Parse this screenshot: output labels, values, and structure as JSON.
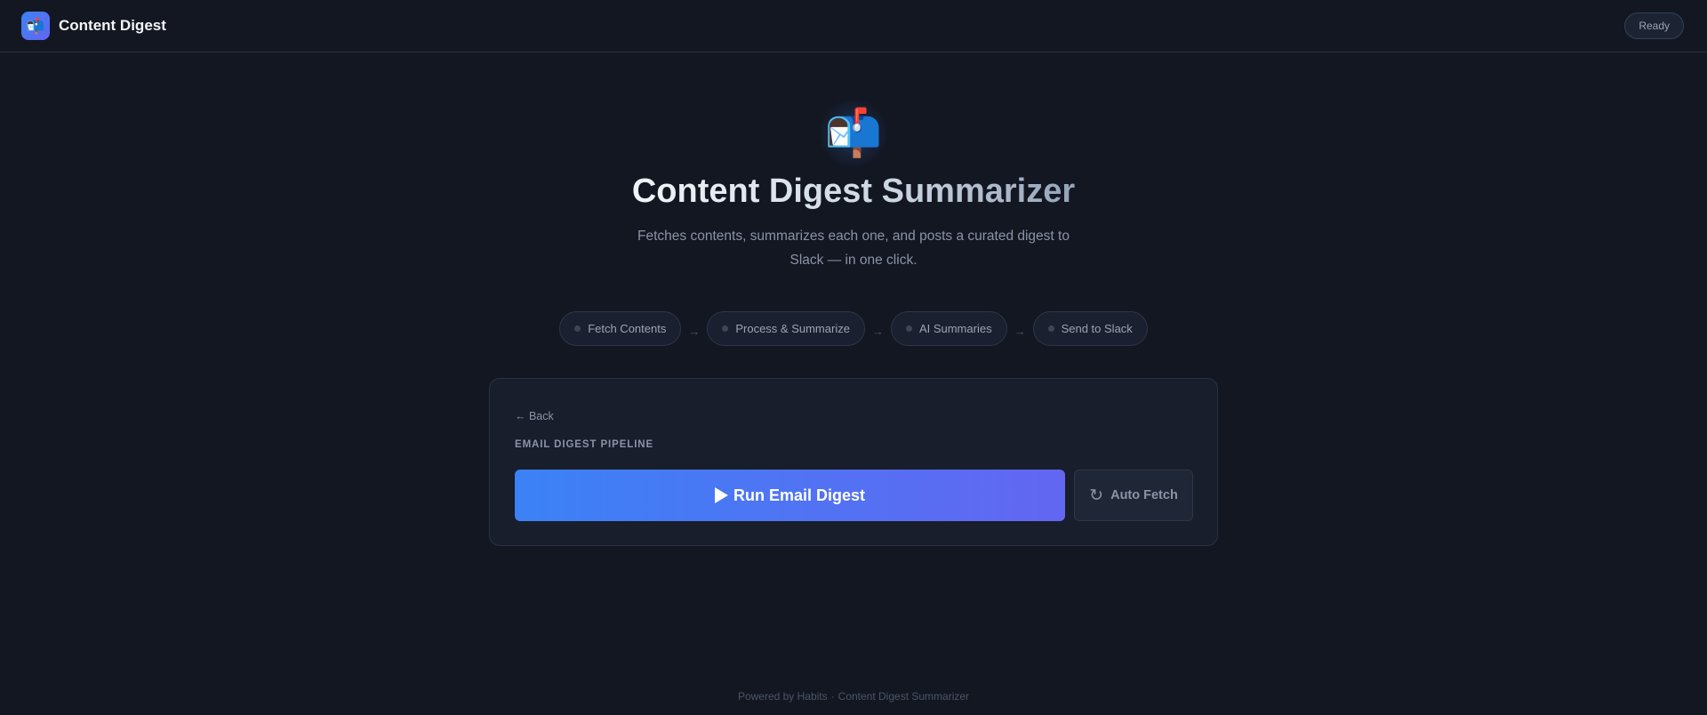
{
  "header": {
    "logo_icon": "📬",
    "app_name": "Content Digest",
    "status": "Ready"
  },
  "hero": {
    "icon": "📬",
    "title": "Content Digest Summarizer",
    "subtitle": "Fetches contents, summarizes each one, and posts a curated digest to Slack — in one click."
  },
  "steps": [
    {
      "label": "Fetch Contents"
    },
    {
      "label": "Process & Summarize"
    },
    {
      "label": "AI Summaries"
    },
    {
      "label": "Send to Slack"
    }
  ],
  "step_arrow": "→",
  "card": {
    "back_label": "← Back",
    "section_label": "EMAIL DIGEST PIPELINE",
    "run_label": "Run Email Digest",
    "auto_fetch_icon": "↻",
    "auto_fetch_label": "Auto Fetch"
  },
  "footer": {
    "powered_by": "Powered by Habits",
    "separator": "·",
    "app": "Content Digest Summarizer"
  },
  "colors": {
    "background": "#131722",
    "accent_start": "#3b82f6",
    "accent_end": "#6366f1"
  }
}
